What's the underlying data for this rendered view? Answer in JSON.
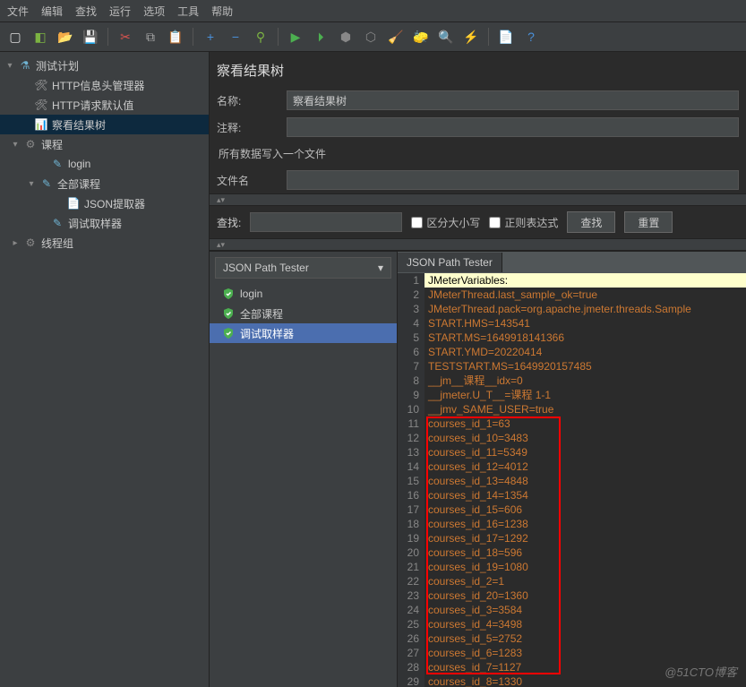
{
  "menu": [
    "文件",
    "编辑",
    "查找",
    "运行",
    "选项",
    "工具",
    "帮助"
  ],
  "tree": {
    "root": "测试计划",
    "items": [
      "HTTP信息头管理器",
      "HTTP请求默认值",
      "察看结果树",
      "课程",
      "login",
      "全部课程",
      "JSON提取器",
      "调试取样器",
      "线程组"
    ]
  },
  "panel": {
    "title": "察看结果树",
    "name_label": "名称:",
    "name_value": "察看结果树",
    "comment_label": "注释:",
    "file_section": "所有数据写入一个文件",
    "filename_label": "文件名",
    "search_label": "查找:",
    "case_label": "区分大小写",
    "regex_label": "正则表达式",
    "find_btn": "查找",
    "reset_btn": "重置"
  },
  "dropdown": "JSON Path Tester",
  "results": [
    "login",
    "全部课程",
    "调试取样器"
  ],
  "tab": "JSON Path Tester",
  "code": [
    "JMeterVariables:",
    "JMeterThread.last_sample_ok=true",
    "JMeterThread.pack=org.apache.jmeter.threads.Sample",
    "START.HMS=143541",
    "START.MS=1649918141366",
    "START.YMD=20220414",
    "TESTSTART.MS=1649920157485",
    "__jm__课程__idx=0",
    "__jmeter.U_T__=课程 1-1",
    "__jmv_SAME_USER=true",
    "courses_id_1=63",
    "courses_id_10=3483",
    "courses_id_11=5349",
    "courses_id_12=4012",
    "courses_id_13=4848",
    "courses_id_14=1354",
    "courses_id_15=606",
    "courses_id_16=1238",
    "courses_id_17=1292",
    "courses_id_18=596",
    "courses_id_19=1080",
    "courses_id_2=1",
    "courses_id_20=1360",
    "courses_id_3=3584",
    "courses_id_4=3498",
    "courses_id_5=2752",
    "courses_id_6=1283",
    "courses_id_7=1127",
    "courses_id_8=1330"
  ],
  "watermark": "@51CTO博客"
}
